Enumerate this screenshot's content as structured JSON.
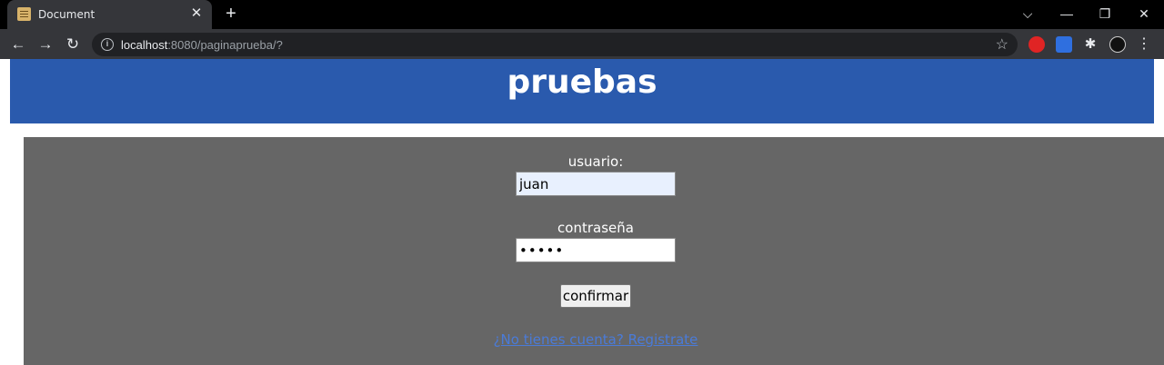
{
  "browser": {
    "tab_title": "Document",
    "tab_close": "✕",
    "new_tab": "+",
    "url_host": "localhost",
    "url_rest": ":8080/paginaprueba/?",
    "window_controls": {
      "dropdown": "⌵",
      "minimize": "—",
      "restore": "❐",
      "close": "✕"
    },
    "icons": [
      "back-arrow-icon",
      "forward-arrow-icon",
      "reload-icon",
      "info-icon",
      "star-icon",
      "extension-icons",
      "menu-icon"
    ]
  },
  "page": {
    "header_title": "pruebas",
    "form": {
      "user_label": "usuario:",
      "user_value": "juan",
      "password_label": "contraseña",
      "password_value": "•••••",
      "confirm_label": "confirmar",
      "register_link": "¿No tienes cuenta? Registrate"
    },
    "colors": {
      "header_bg": "#2a5aad",
      "panel_bg": "#666666",
      "link": "#4a7bd8"
    }
  }
}
